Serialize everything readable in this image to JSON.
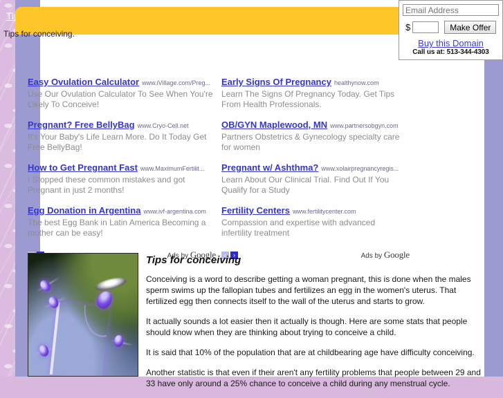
{
  "banner": {
    "title": "Tips for conceiving",
    "subtitle": "Tips for conceiving."
  },
  "offer_panel": {
    "email_placeholder": "Email Address",
    "email_value": "",
    "currency_symbol": "$",
    "amount_placeholder": "",
    "amount_value": "",
    "make_offer_label": "Make Offer",
    "buy_domain_label": "Buy this Domain",
    "call_us_text": "Call us at: 513-344-4303"
  },
  "ads": {
    "left_column": [
      {
        "title": "Easy Ovulation Calculator",
        "url": "www.iVillage.com/Preg...",
        "description": "Use Our Ovulation Calculator To See When You're Likely To Conceive!"
      },
      {
        "title": "Pregnant? Free BellyBag",
        "url": "www.Cryo-Cell.net",
        "description": "It's Your Baby's Life Learn More. Do It Today Get Free BellyBag!"
      },
      {
        "title": "How to Get Pregnant Fast",
        "url": "www.MaximumFertilit...",
        "description": "I Stopped these common mistakes and got Pregnant in just 2 months!"
      },
      {
        "title": "Egg Donation in Argentina",
        "url": "www.ivf-argentina.com",
        "description": "The best Egg Bank in Latin America Becoming a mother can be easy!"
      }
    ],
    "right_column": [
      {
        "title": "Early Signs Of Pregnancy",
        "url": "healthynow.com",
        "description": "Learn The Signs Of Pregnancy Today. Get Tips From Health Professionals."
      },
      {
        "title": "OB/GYN Maplewood, MN",
        "url": "www.partnersobgyn.com",
        "description": "Partners Obstetrics & Gynecology specialty care for women"
      },
      {
        "title": "Pregnant w/ Ashthma?",
        "url": "www.xolairpregnancyregis...",
        "description": "Learn About Our Clinical Trial. Find Out If You Qualify for a Study"
      },
      {
        "title": "Fertility Centers",
        "url": "www.fertilitycenter.com",
        "description": "Compassion and expertise with advanced infertility treatment"
      }
    ],
    "footer": {
      "prev_arrow": "‹",
      "next_arrow": "›",
      "ads_by_prefix": "Ads by ",
      "ads_by_brand": "Google"
    }
  },
  "article": {
    "heading": "Tips for conceiving",
    "image_alt": "sperm-fertilizing-egg-illustration",
    "paragraphs": [
      "Conceiving is a word to describe getting a woman pregnant, this is done when the males sperm swims up the fallopian tubes and fertilizes an egg in the women's uterus.  That fertilized egg then connects itself to the wall of the uterus and starts to grow.",
      "It actually sounds a lot easier then it actually is though.  Here are some stats that people should know when they are thinking about trying to conceive a child.",
      "It is said that 10% of the population that are at childbearing age have difficulty conceiving.",
      "Another statistic is that even if their aren't any fertility problems that people between 29 and 33 have only around a 25% chance to conceive a child during any menstrual cycle."
    ]
  },
  "colors": {
    "banner_yellow": "#ffc629",
    "side_band_purple": "#9b9bd2",
    "page_background": "#dcbbe0",
    "ad_link_blue": "#3535cc",
    "domain_link_blue": "#3b3bdd"
  }
}
